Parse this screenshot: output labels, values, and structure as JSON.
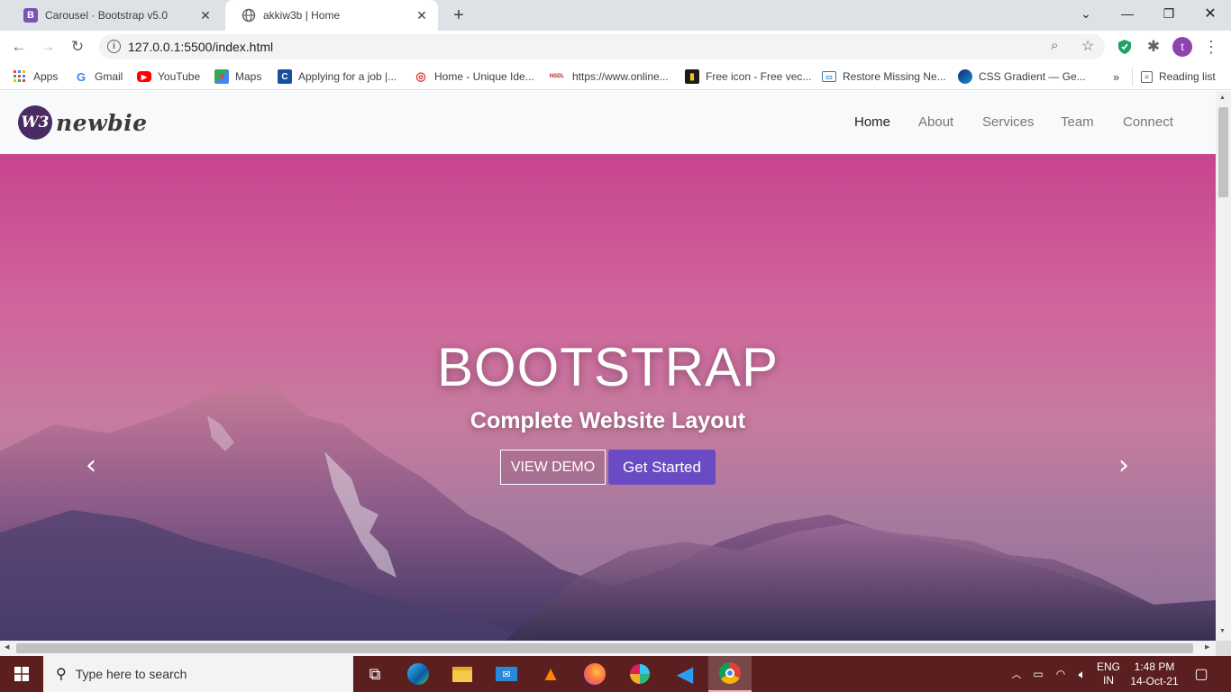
{
  "browser": {
    "tabs": [
      {
        "title": "Carousel · Bootstrap v5.0",
        "favicon_letter": "B",
        "favicon_color": "#7952b3"
      },
      {
        "title": "akkiw3b | Home"
      }
    ],
    "url": "127.0.0.1:5500/index.html",
    "profile_initial": "t"
  },
  "bookmarks": [
    {
      "label": "Apps",
      "icon": "apps-grid-icon"
    },
    {
      "label": "Gmail",
      "icon": "google-icon"
    },
    {
      "label": "YouTube",
      "icon": "youtube-icon"
    },
    {
      "label": "Maps",
      "icon": "maps-icon"
    },
    {
      "label": "Applying for a job |...",
      "icon": "c-icon"
    },
    {
      "label": "Home - Unique Ide...",
      "icon": "fingerprint-icon"
    },
    {
      "label": "https://www.online...",
      "icon": "nsdl-icon",
      "icon_text": "NSDL"
    },
    {
      "label": "Free icon - Free vec...",
      "icon": "flaticon-icon"
    },
    {
      "label": "Restore Missing Ne...",
      "icon": "monitor-icon"
    },
    {
      "label": "CSS Gradient — Ge...",
      "icon": "gradient-icon"
    }
  ],
  "reading_list": "Reading list",
  "site": {
    "logo_mark": "W3",
    "logo_text": "newbie",
    "nav": [
      {
        "label": "Home",
        "active": true
      },
      {
        "label": "About"
      },
      {
        "label": "Services"
      },
      {
        "label": "Team"
      },
      {
        "label": "Connect"
      }
    ],
    "hero": {
      "title": "BOOTSTRAP",
      "subtitle": "Complete Website Layout",
      "demo_button": "VIEW DEMO",
      "start_button": "Get Started"
    }
  },
  "taskbar": {
    "search_placeholder": "Type here to search",
    "lang_top": "ENG",
    "lang_bottom": "IN",
    "time": "1:48 PM",
    "date": "14-Oct-21"
  },
  "colors": {
    "accent_button": "#6a4bc4",
    "hero_top": "#c8448e",
    "taskbar": "#5b1f1f"
  }
}
